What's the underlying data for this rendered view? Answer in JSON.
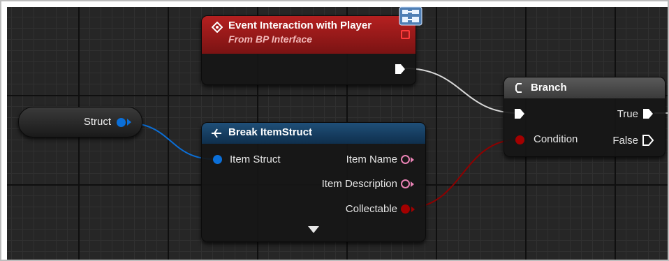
{
  "graph": {
    "struct_node": {
      "label": "Struct"
    },
    "event_node": {
      "title": "Event Interaction with Player",
      "subtitle": "From BP Interface"
    },
    "break_node": {
      "title": "Break ItemStruct",
      "pins_in": [
        "Item Struct"
      ],
      "pins_out": [
        "Item Name",
        "Item Description",
        "Collectable"
      ]
    },
    "branch_node": {
      "title": "Branch",
      "condition_label": "Condition",
      "true_label": "True",
      "false_label": "False"
    }
  },
  "colors": {
    "event_header": "#a11a1a",
    "struct_pin": "#0b6fd8",
    "string_pin": "#e882b4",
    "bool_pin": "#a30000",
    "exec_wire": "#d9d9d9"
  }
}
